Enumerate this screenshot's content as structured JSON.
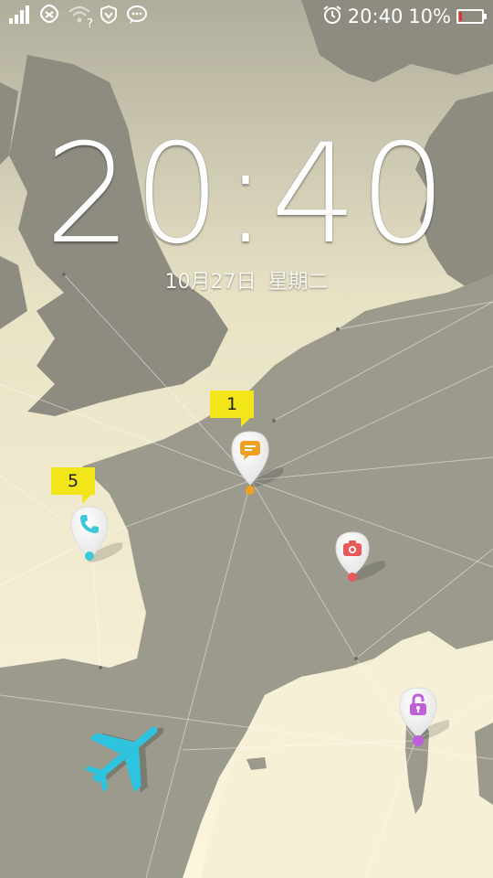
{
  "statusbar": {
    "time": "20:40",
    "battery": "10%",
    "icons": [
      "signal-icon",
      "unicom-icon",
      "wifi-icon",
      "shield-icon",
      "chat-icon",
      "alarm-icon",
      "battery-icon"
    ],
    "wifi_hint": "?"
  },
  "lockscreen": {
    "clock": "20:40",
    "date": "10月27日 星期二"
  },
  "pins": {
    "messages": {
      "icon": "message-icon",
      "badge": "1",
      "color": "#f0a020"
    },
    "phone": {
      "icon": "phone-icon",
      "badge": "5",
      "color": "#3cc8d8"
    },
    "camera": {
      "icon": "camera-icon",
      "color": "#e85a5a"
    },
    "unlock": {
      "icon": "lock-icon",
      "color": "#c060d8"
    }
  },
  "decor": {
    "plane_color": "#2ec3de",
    "land_color": "#9c9a8d",
    "sea_color": "#f5f0d6"
  }
}
